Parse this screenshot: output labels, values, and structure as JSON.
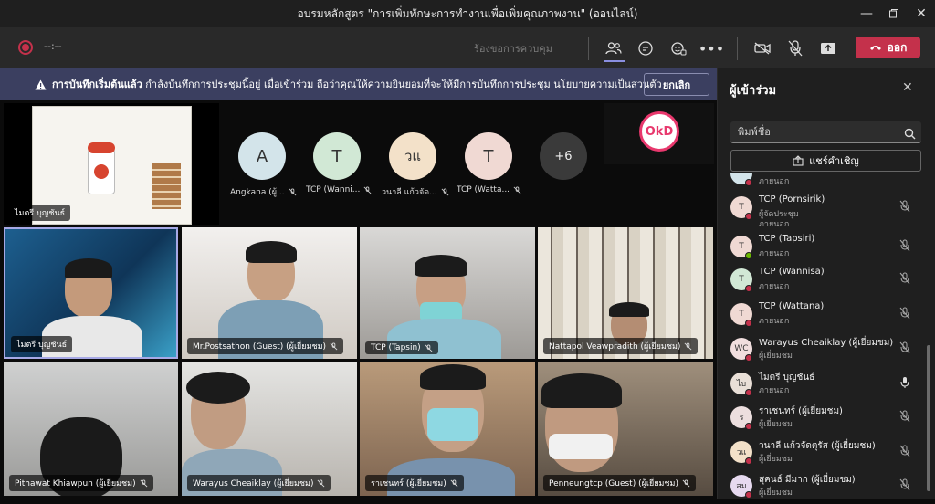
{
  "window": {
    "title": "อบรมหลักสูตร \"การเพิ่มทักษะการทำงานเพื่อเพิ่มคุณภาพงาน\" (ออนไลน์)"
  },
  "toolbar": {
    "timer": "--:--",
    "request_control": "ร้องขอการควบคุม",
    "leave_label": "ออก"
  },
  "banner": {
    "bold": "การบันทึกเริ่มต้นแล้ว",
    "text": "กำลังบันทึกการประชุมนี้อยู่ เมื่อเข้าร่วม ถือว่าคุณให้ความยินยอมที่จะให้มีการบันทึกการประชุม",
    "link": "นโยบายความเป็นส่วนตัว",
    "cancel": "ยกเลิก"
  },
  "share": {
    "presenter": "ไมตรี บุญชันธ์"
  },
  "avatars": [
    {
      "initial": "A",
      "name": "Angkana (ผู้...",
      "color": "#d3e4ea"
    },
    {
      "initial": "T",
      "name": "TCP (Wanni...",
      "color": "#d1e8d5"
    },
    {
      "initial": "วแ",
      "name": "วนาลี แก้วจัด...",
      "color": "#f3e1c9"
    },
    {
      "initial": "T",
      "name": "TCP (Watta...",
      "color": "#f0d9d3"
    }
  ],
  "overflow_count": "+6",
  "logo_text": "OkD",
  "tiles": [
    {
      "name": "ไมตรี บุญชันธ์"
    },
    {
      "name": "Mr.Postsathon (Guest) (ผู้เยี่ยมชม)"
    },
    {
      "name": "TCP (Tapsin)"
    },
    {
      "name": "Nattapol Veawpradith (ผู้เยี่ยมชม)"
    },
    {
      "name": "Pithawat Khiawpun (ผู้เยี่ยมชม)"
    },
    {
      "name": "Warayus Cheaiklay (ผู้เยี่ยมชม)"
    },
    {
      "name": "ราเชนทร์ (ผู้เยี่ยมชม)"
    },
    {
      "name": "Penneungtcp (Guest) (ผู้เยี่ยมชม)"
    }
  ],
  "panel": {
    "title": "ผู้เข้าร่วม",
    "search_placeholder": "พิมพ์ชื่อ",
    "invite": "แชร์คำเชิญ",
    "participants": [
      {
        "initial": "T",
        "name": "TCP (Pornsirik)",
        "sub1": "ผู้จัดประชุม",
        "sub2": "ภายนอก",
        "color": "#f0d9d3",
        "status": "#c4314b"
      },
      {
        "initial": "T",
        "name": "TCP (Tapsiri)",
        "sub1": "ภายนอก",
        "sub2": "",
        "color": "#f0d9d3",
        "status": "#6bb700"
      },
      {
        "initial": "T",
        "name": "TCP (Wannisa)",
        "sub1": "ภายนอก",
        "sub2": "",
        "color": "#d1e8d5",
        "status": "#c4314b"
      },
      {
        "initial": "T",
        "name": "TCP (Wattana)",
        "sub1": "ภายนอก",
        "sub2": "",
        "color": "#f0d9d3",
        "status": "#c4314b"
      },
      {
        "initial": "WC",
        "name": "Warayus Cheaiklay (ผู้เยี่ยมชม)",
        "sub1": "ผู้เยี่ยมชม",
        "sub2": "",
        "color": "#f1dede",
        "status": "#c4314b"
      },
      {
        "initial": "ไบ",
        "name": "ไมตรี บุญชันธ์",
        "sub1": "ภายนอก",
        "sub2": "",
        "color": "#e9dfd7",
        "status": "#c4314b"
      },
      {
        "initial": "ร",
        "name": "ราเชนทร์ (ผู้เยี่ยมชม)",
        "sub1": "ผู้เยี่ยมชม",
        "sub2": "",
        "color": "#ecdede",
        "status": "#c4314b"
      },
      {
        "initial": "วแ",
        "name": "วนาลี แก้วจัดตุรัส (ผู้เยี่ยมชม)",
        "sub1": "ผู้เยี่ยมชม",
        "sub2": "",
        "color": "#f3e1c9",
        "status": "#c4314b"
      },
      {
        "initial": "สม",
        "name": "สุคนธ์ มีมาก (ผู้เยี่ยมชม)",
        "sub1": "ผู้เยี่ยมชม",
        "sub2": "",
        "color": "#e6d9ef",
        "status": "#c4314b"
      }
    ],
    "top_partial_sub": "ภายนอก"
  },
  "icons": [
    "record-icon",
    "people-icon",
    "chat-icon",
    "reactions-icon",
    "more-icon",
    "camera-off-icon",
    "mic-off-icon",
    "share-icon",
    "phone-icon",
    "warning-icon",
    "search-icon",
    "close-icon",
    "invite-icon",
    "mic-icon"
  ]
}
